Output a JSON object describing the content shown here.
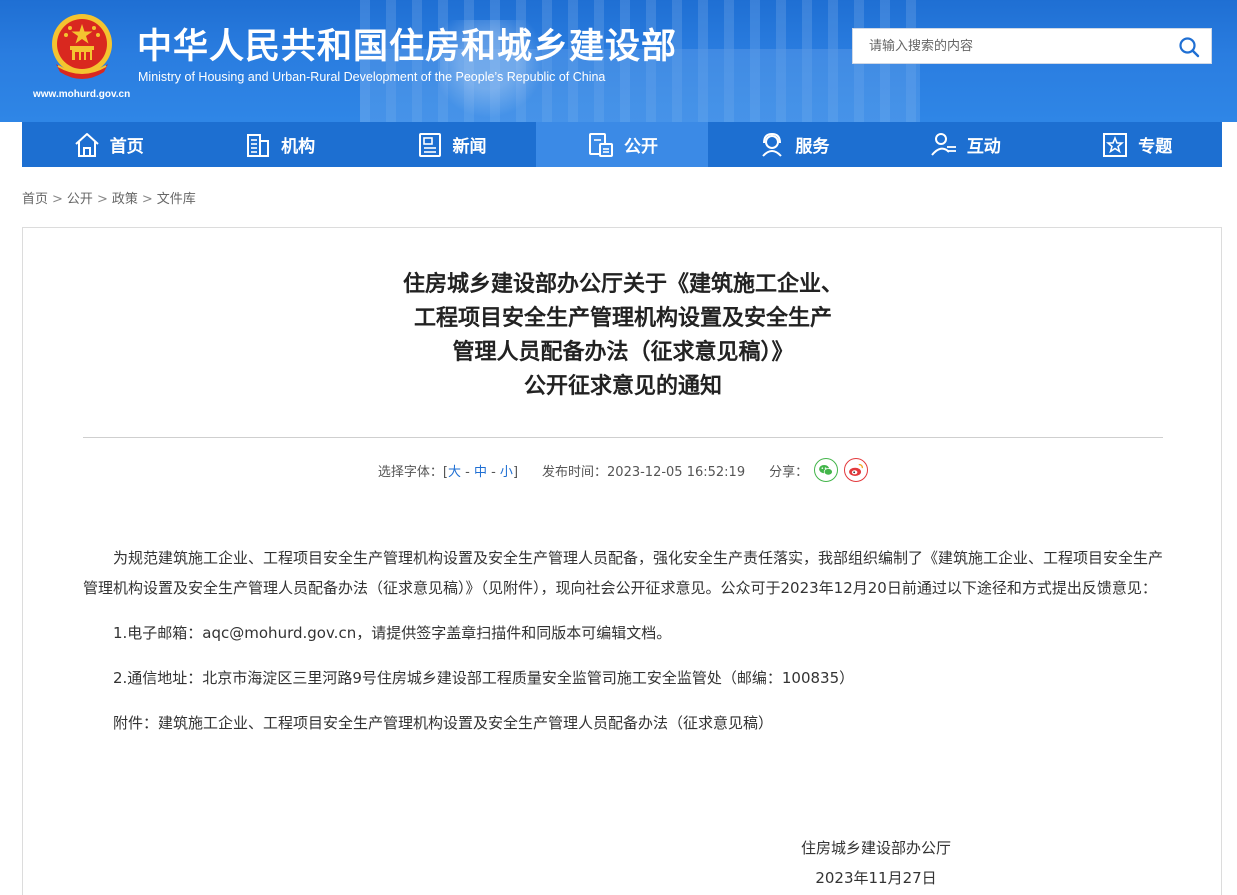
{
  "header": {
    "site_name_cn": "中华人民共和国住房和城乡建设部",
    "site_name_en": "Ministry of Housing and Urban-Rural Development of the People’s Republic of China",
    "site_url": "www.mohurd.gov.cn",
    "emblem_icon": "national-emblem-icon"
  },
  "search": {
    "placeholder": "请输入搜索的内容",
    "icon": "search-icon"
  },
  "nav": {
    "items": [
      {
        "label": "首页",
        "icon": "home-icon"
      },
      {
        "label": "机构",
        "icon": "building-icon"
      },
      {
        "label": "新闻",
        "icon": "news-icon"
      },
      {
        "label": "公开",
        "icon": "document-icon",
        "active": true
      },
      {
        "label": "服务",
        "icon": "service-icon"
      },
      {
        "label": "互动",
        "icon": "interaction-icon"
      },
      {
        "label": "专题",
        "icon": "topic-star-icon"
      }
    ]
  },
  "breadcrumb": {
    "items": [
      "首页",
      "公开",
      "政策",
      "文件库"
    ],
    "separator": ">"
  },
  "article": {
    "title_lines": [
      "住房城乡建设部办公厅关于《建筑施工企业、",
      "工程项目安全生产管理机构设置及安全生产",
      "管理人员配备办法（征求意见稿）》",
      "公开征求意见的通知"
    ],
    "font_size_label": "选择字体：[",
    "font_size_large": "大",
    "font_size_medium": "中",
    "font_size_small": "小",
    "font_size_end": "]",
    "font_size_dash": " - ",
    "publish_label": "发布时间：",
    "publish_time": "2023-12-05 16:52:19",
    "share_label": "分享：",
    "share_icons": [
      "wechat-icon",
      "weibo-icon"
    ],
    "paragraph_1": "为规范建筑施工企业、工程项目安全生产管理机构设置及安全生产管理人员配备，强化安全生产责任落实，我部组织编制了《建筑施工企业、工程项目安全生产管理机构设置及安全生产管理人员配备办法（征求意见稿）》（见附件），现向社会公开征求意见。公众可于2023年12月20日前通过以下途径和方式提出反馈意见：",
    "item_1": "1.电子邮箱：aqc@mohurd.gov.cn，请提供签字盖章扫描件和同版本可编辑文档。",
    "item_2": "2.通信地址：北京市海淀区三里河路9号住房城乡建设部工程质量安全监管司施工安全监管处（邮编：100835）",
    "attachment": "附件：建筑施工企业、工程项目安全生产管理机构设置及安全生产管理人员配备办法（征求意见稿）",
    "signature_org": "住房城乡建设部办公厅",
    "signature_date": "2023年11月27日"
  },
  "colors": {
    "header_blue": "#2a7de0",
    "nav_blue": "#1d6fd1",
    "nav_active": "#3b8ae6",
    "link_blue": "#1f6fd3",
    "wechat_green": "#43b54a",
    "weibo_red": "#e3393c"
  }
}
